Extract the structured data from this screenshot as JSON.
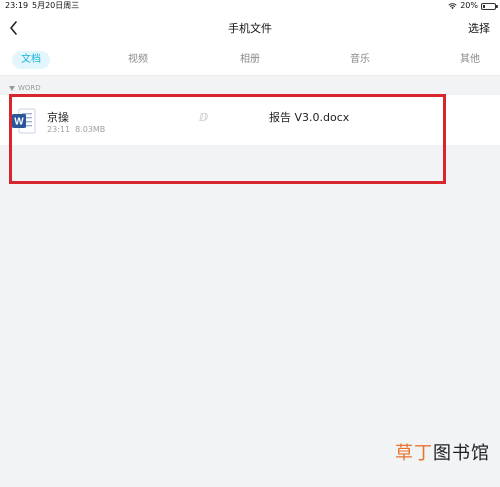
{
  "status_bar": {
    "time": "23:19",
    "date": "5月20日周三",
    "battery_text": "20%",
    "battery_level": 0.2
  },
  "nav": {
    "title": "手机文件",
    "select_label": "选择"
  },
  "tabs": [
    {
      "label": "文档",
      "active": true
    },
    {
      "label": "视频",
      "active": false
    },
    {
      "label": "相册",
      "active": false
    },
    {
      "label": "音乐",
      "active": false
    },
    {
      "label": "其他",
      "active": false
    }
  ],
  "section": {
    "label": "WORD"
  },
  "file": {
    "name_start": "京操",
    "name_middle": "ⅅ",
    "name_end": "报告 V3.0.docx",
    "time": "23:11",
    "size": "8.03MB",
    "icon_letter": "W"
  },
  "watermark": {
    "accent": "草丁",
    "rest": "图书馆"
  },
  "colors": {
    "accent": "#18b3d8",
    "highlight": "#d7262e",
    "word_blue": "#2b579a"
  }
}
